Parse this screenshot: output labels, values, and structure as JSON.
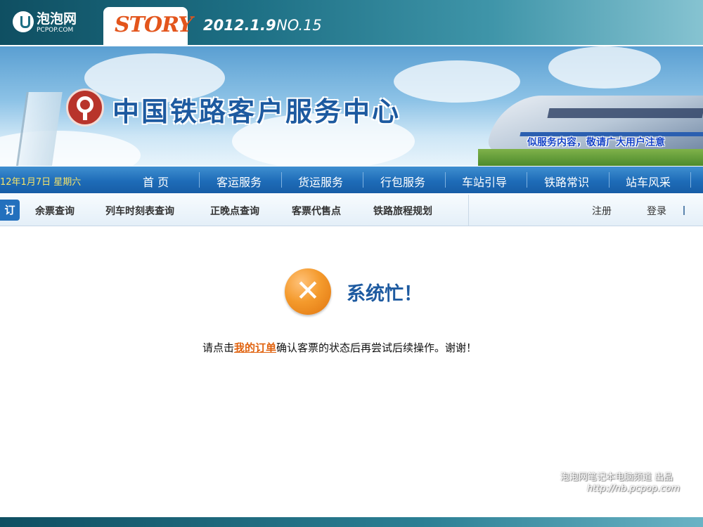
{
  "magazine": {
    "site_name": "泡泡网",
    "site_url": "PCPOP.COM",
    "column": "STORY",
    "date": "2012.1.9",
    "issue": "NO.15"
  },
  "banner": {
    "title": "中国铁路客户服务中心",
    "notice": "似服务内容，敬请广大用户注意"
  },
  "main_nav": {
    "date": "12年1月7日 星期六",
    "items": [
      "首 页",
      "客运服务",
      "货运服务",
      "行包服务",
      "车站引导",
      "铁路常识",
      "站车风采"
    ]
  },
  "sub_nav": {
    "active_label": "订",
    "items": [
      "余票查询",
      "列车时刻表查询",
      "正晚点查询",
      "客票代售点",
      "铁路旅程规划"
    ],
    "register": "注册",
    "login": "登录"
  },
  "message": {
    "icon": "error-x-icon",
    "title": "系统忙！",
    "text_before": "请点击",
    "link": "我的订单",
    "text_after": "确认客票的状态后再尝试后续操作。谢谢！"
  },
  "watermark": {
    "line1": "泡泡网笔记本电脑频道 出品",
    "line2": "http://nb.pcpop.com"
  },
  "colors": {
    "nav_blue": "#1e6cb8",
    "title_blue": "#1d5aa0",
    "link_orange": "#e0620e",
    "date_yellow": "#f5e36a"
  }
}
